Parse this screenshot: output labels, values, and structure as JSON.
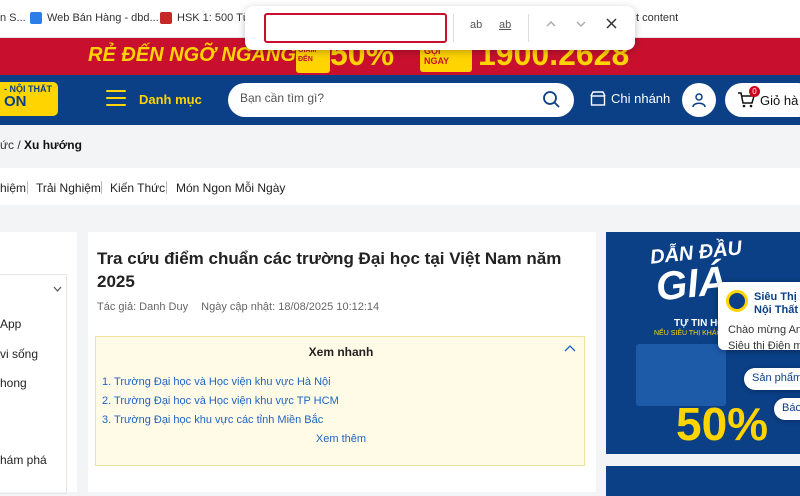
{
  "bookmarks": [
    {
      "label": "n S...",
      "color": "#888888"
    },
    {
      "label": "Web Bán Hàng - dbd...",
      "color": "#2b7de9"
    },
    {
      "label": "HSK 1: 500 Từ V...",
      "color": "#c62828"
    },
    {
      "label": "t content",
      "color": "#ffffff"
    }
  ],
  "find_bar": {
    "value": "",
    "match_case_label": "ab",
    "whole_word_label": "ab",
    "prev_glyph": "⌃",
    "next_glyph": "⌄",
    "close_glyph": "✕"
  },
  "promo": {
    "slogan": "RẺ ĐẾN NGỠ NGÀNG",
    "badge_text": "GIẢM ĐẾN",
    "percent": "50%",
    "hotline_label": "GỌI NGAY",
    "hotline": "1900.2628"
  },
  "header": {
    "logo_top": "- NỘI THẤT",
    "logo_bottom": "ON",
    "menu_label": "Danh mục",
    "search_placeholder": "Bạn cần tìm gì?",
    "branch_label": "Chi nhánh",
    "cart_label": "Giỏ hà",
    "cart_count": "0",
    "colors": {
      "primary": "#0b3f86",
      "accent": "#ffd400",
      "promo": "#c8102e"
    }
  },
  "breadcrumb": {
    "prefix": "ức /",
    "current": "Xu hướng"
  },
  "categories": [
    "hiệm",
    "Trải Nghiệm",
    "Kiến Thức",
    "Món Ngon Mỗi Ngày"
  ],
  "sidebar": {
    "items": [
      "App",
      "vi sống",
      "hong",
      "hám phá"
    ]
  },
  "article": {
    "title": "Tra cứu điểm chuẩn các trường Đại học tại Việt Nam năm 2025",
    "author_label": "Tác giả: Danh Duy",
    "updated_label": "Ngày cập nhật: 18/08/2025 10:12:14",
    "toc": {
      "heading": "Xem nhanh",
      "items": [
        "1. Trường Đại học và Học viện khu vực Hà Nội",
        "2. Trường Đại học và Học viện khu vực TP HCM",
        "3. Trường Đại học khu vực các tỉnh Miền Bắc"
      ],
      "more_label": "Xem thêm"
    }
  },
  "ad": {
    "line1": "DẪN ĐẦU",
    "line2": "GIÁ",
    "tag1": "TỰ TIN HO",
    "tag2": "NẾU SIÊU THỊ KHÁC",
    "percent": "50%"
  },
  "chat": {
    "name": "Siêu Thị Đ Nội Thất",
    "message": "Chào mừng An Siêu thị Điện m",
    "chips": [
      "Sản phẩm",
      "Báo"
    ]
  }
}
